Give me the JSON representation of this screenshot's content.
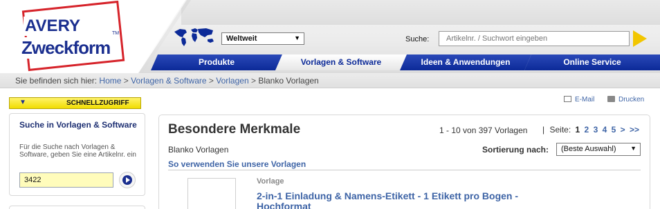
{
  "brand": {
    "line1": "AVERY",
    "line2": "Zweckform",
    "tm": "TM",
    "colors": {
      "blue": "#1b2f8f",
      "red": "#d6232a",
      "yellow": "#f2c600",
      "link": "#3e64a6"
    }
  },
  "header": {
    "region": {
      "selected": "Weltweit",
      "icon": "world-map-icon"
    },
    "search": {
      "label": "Suche:",
      "placeholder": "Artikelnr. / Suchwort eingeben",
      "go_icon": "triangle-right-icon"
    }
  },
  "nav": {
    "tabs": [
      {
        "label": "Produkte"
      },
      {
        "label": "Vorlagen & Software",
        "active": true
      },
      {
        "label": "Ideen & Anwendungen"
      },
      {
        "label": "Online Service"
      }
    ]
  },
  "breadcrumb": {
    "prefix": "Sie befinden sich hier:",
    "items": [
      "Home",
      "Vorlagen & Software",
      "Vorlagen"
    ],
    "current": "Blanko Vorlagen",
    "separator": ">"
  },
  "sidebar": {
    "quick_access": {
      "label": "SCHNELLZUGRIFF",
      "icon": "triangle-down-icon"
    },
    "template_search": {
      "title": "Suche in Vorlagen & Software",
      "description": "Für die Suche nach Vorlagen & Software, geben Sie eine Artikelnr. ein",
      "value": "3422",
      "go_icon": "play-circle-icon"
    }
  },
  "utility": {
    "email": "E-Mail",
    "print": "Drucken"
  },
  "results": {
    "title": "Besondere Merkmale",
    "count_text": "1 - 10 von 397 Vorlagen",
    "pagination": {
      "label": "Seite:",
      "current": "1",
      "pages": [
        "2",
        "3",
        "4",
        "5"
      ],
      "next": ">",
      "last": ">>"
    },
    "subtitle": "Blanko Vorlagen",
    "sort": {
      "label": "Sortierung nach:",
      "selected": "(Beste Auswahl)"
    },
    "usage_link": "So verwenden Sie unsere Vorlagen",
    "items": [
      {
        "category": "Vorlage",
        "title": "2-in-1 Einladung & Namens-Etikett - 1 Etikett pro Bogen - Hochformat"
      }
    ]
  }
}
